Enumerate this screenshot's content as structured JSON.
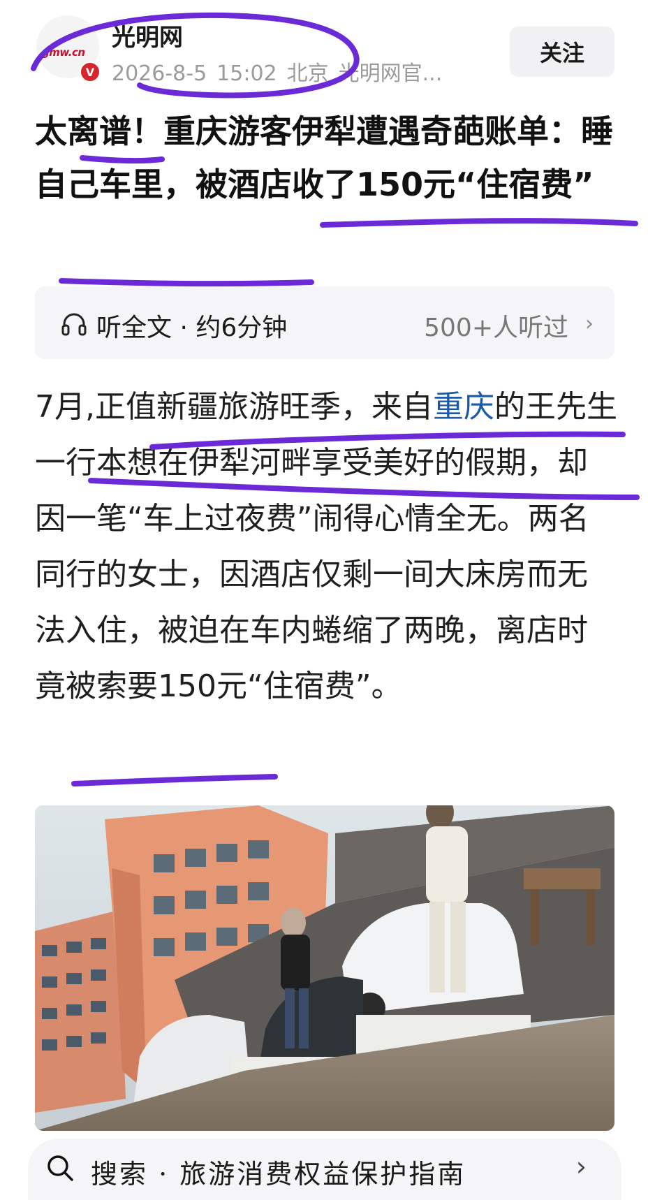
{
  "header": {
    "avatar_text": "光明网 gmw.cn",
    "verified_badge": "V",
    "source_name": "光明网",
    "date": "2026-8-5",
    "time": "15:02",
    "location": "北京",
    "account": "光明网官...",
    "follow_label": "关注"
  },
  "article": {
    "title": "太离谱！重庆游客伊犁遭遇奇葩账单：睡自己车里，被酒店收了150元“住宿费”",
    "listen": {
      "label": "听全文 · 约6分钟",
      "count": "500+人听过"
    },
    "body": {
      "part1": "7月,正值新疆旅游旺季，来自",
      "link_text": "重庆",
      "part2": "的王先生一行本想在伊犁河畔享受美好的假期，却因一笔“车上过夜费”闹得心情全无。两名同行的女士，因酒店仅剩一间大床房而无法入住，被迫在车内蜷缩了两晚，离店时竟被索要150元“住宿费”。"
    }
  },
  "search": {
    "label": "搜索 · 旅游消费权益保护指南"
  },
  "colors": {
    "accent_link": "#1a5aa8",
    "marker": "#6a2ad8",
    "brand_red": "#c8102e"
  }
}
